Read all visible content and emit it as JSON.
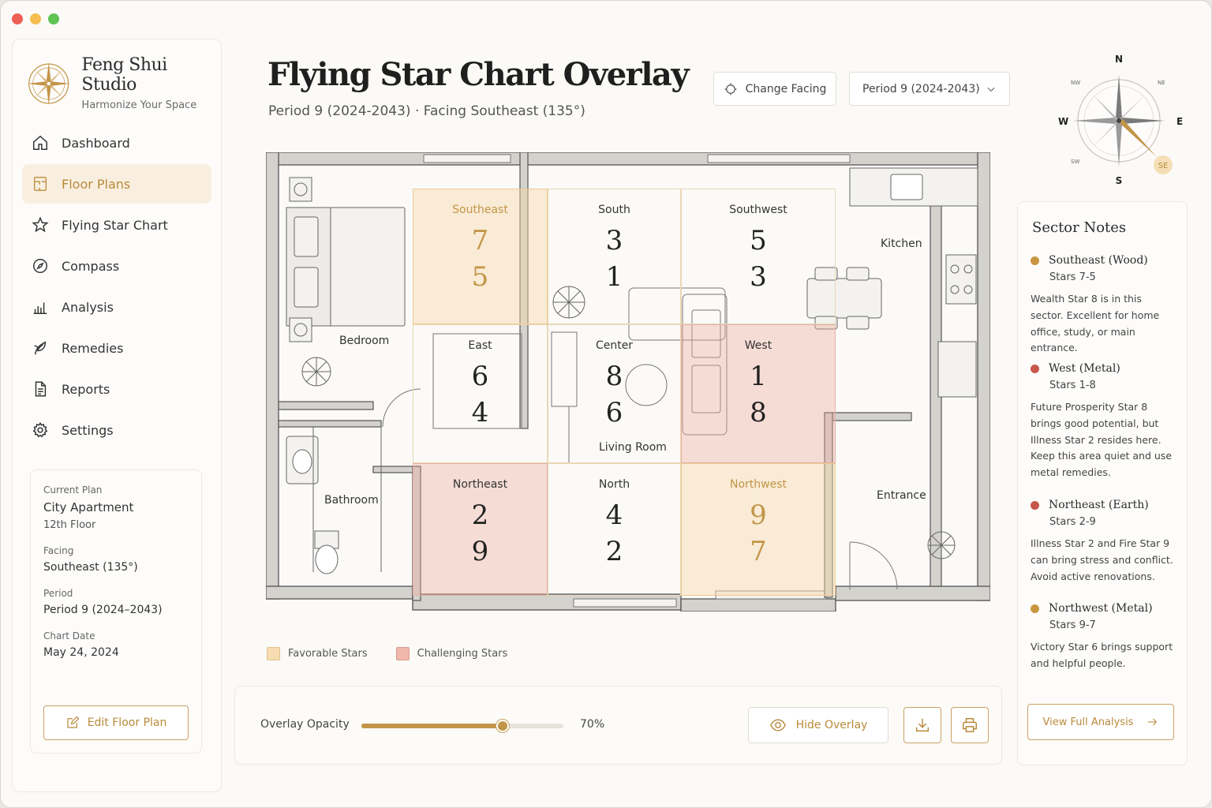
{
  "brand": {
    "name": "Feng Shui Studio",
    "tagline": "Harmonize Your Space"
  },
  "nav": [
    {
      "label": "Dashboard",
      "icon": "home-icon",
      "active": false
    },
    {
      "label": "Floor Plans",
      "icon": "floor-plan-icon",
      "active": true
    },
    {
      "label": "Flying Star Chart",
      "icon": "star-icon",
      "active": false
    },
    {
      "label": "Compass",
      "icon": "compass-icon",
      "active": false
    },
    {
      "label": "Analysis",
      "icon": "bar-chart-icon",
      "active": false
    },
    {
      "label": "Remedies",
      "icon": "plant-icon",
      "active": false
    },
    {
      "label": "Reports",
      "icon": "document-icon",
      "active": false
    },
    {
      "label": "Settings",
      "icon": "gear-icon",
      "active": false
    }
  ],
  "plan_card": {
    "current_plan_label": "Current Plan",
    "current_plan": "City Apartment",
    "floor": "12th Floor",
    "facing_label": "Facing",
    "facing": "Southeast (135°)",
    "period_label": "Period",
    "period": "Period 9 (2024–2043)",
    "chart_date_label": "Chart Date",
    "chart_date": "May 24, 2024",
    "edit_button": "Edit Floor Plan"
  },
  "header": {
    "title": "Flying Star Chart Overlay",
    "subtitle": "Period 9 (2024-2043) · Facing Southeast (135°)",
    "change_facing": "Change Facing",
    "period_select": "Period 9 (2024-2043)"
  },
  "compass": {
    "n": "N",
    "s": "S",
    "e": "E",
    "w": "W",
    "nw": "NW",
    "ne": "NE",
    "sw": "SW",
    "se": "SE",
    "facing_marker": "SE"
  },
  "sectors": [
    {
      "name": "Southeast",
      "top": "7",
      "bottom": "5",
      "tone": "fav"
    },
    {
      "name": "South",
      "top": "3",
      "bottom": "1",
      "tone": "none"
    },
    {
      "name": "Southwest",
      "top": "5",
      "bottom": "3",
      "tone": "none"
    },
    {
      "name": "East",
      "top": "6",
      "bottom": "4",
      "tone": "none"
    },
    {
      "name": "Center",
      "top": "8",
      "bottom": "6",
      "tone": "none"
    },
    {
      "name": "West",
      "top": "1",
      "bottom": "8",
      "tone": "chal"
    },
    {
      "name": "Northeast",
      "top": "2",
      "bottom": "9",
      "tone": "chal"
    },
    {
      "name": "North",
      "top": "4",
      "bottom": "2",
      "tone": "none"
    },
    {
      "name": "Northwest",
      "top": "9",
      "bottom": "7",
      "tone": "fav"
    }
  ],
  "rooms": {
    "bedroom": "Bedroom",
    "bathroom": "Bathroom",
    "living_room": "Living Room",
    "kitchen": "Kitchen",
    "entrance": "Entrance"
  },
  "legend": {
    "favorable": "Favorable Stars",
    "challenging": "Challenging Stars"
  },
  "overlay": {
    "opacity_label": "Overlay Opacity",
    "opacity_value": "70%",
    "opacity_fraction": 0.7,
    "hide_button": "Hide Overlay"
  },
  "notes": {
    "title": "Sector Notes",
    "items": [
      {
        "heading": "Southeast (Wood)",
        "stars": "Stars 7-5",
        "desc": "Wealth Star 8 is in this sector. Excellent for home office, study, or main entrance.",
        "color": "#c9963f"
      },
      {
        "heading": "West (Metal)",
        "stars": "Stars 1-8",
        "desc": "Future Prosperity Star 8 brings good potential, but Illness Star 2 resides here. Keep this area quiet and use metal remedies.",
        "color": "#c6584a"
      },
      {
        "heading": "Northeast (Earth)",
        "stars": "Stars 2-9",
        "desc": "Illness Star 2 and Fire Star 9 can bring stress and conflict. Avoid active renovations.",
        "color": "#c6584a"
      },
      {
        "heading": "Northwest (Metal)",
        "stars": "Stars 9-7",
        "desc": "Victory Star 6 brings support and helpful people.",
        "color": "#c9963f"
      }
    ],
    "full_button": "View Full Analysis"
  }
}
